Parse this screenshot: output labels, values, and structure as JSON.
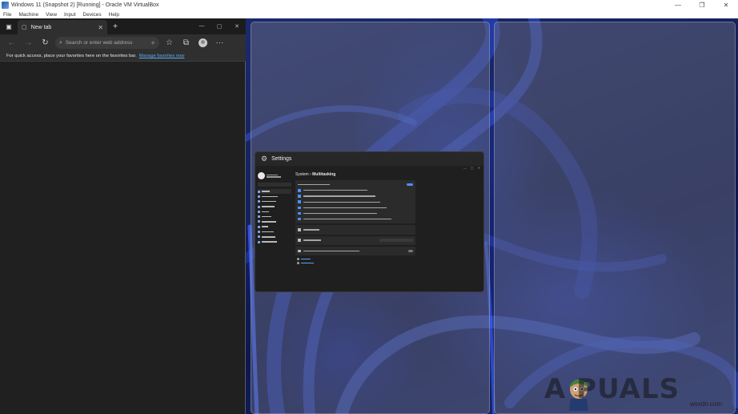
{
  "vbox": {
    "title": "Windows 11 (Snapshot 2) [Running] - Oracle VM VirtualBox",
    "menu": [
      "File",
      "Machine",
      "View",
      "Input",
      "Devices",
      "Help"
    ],
    "controls": [
      "—",
      "❐",
      "✕"
    ]
  },
  "edge": {
    "tab_title": "New tab",
    "address_placeholder": "Search or enter web address",
    "favorites_message": "For quick access, place your favorites here on the favorites bar.",
    "manage_favorites_link": "Manage favorites now"
  },
  "settings": {
    "title": "Settings",
    "breadcrumb_parent": "System",
    "breadcrumb_sep": "›",
    "breadcrumb_current": "Multitasking"
  },
  "watermark": {
    "brand": "A  PUALS",
    "site": "wsxdn.com"
  },
  "colors": {
    "accent": "#4f8fff",
    "link": "#5aaaf0",
    "edge_bg": "#202020"
  }
}
